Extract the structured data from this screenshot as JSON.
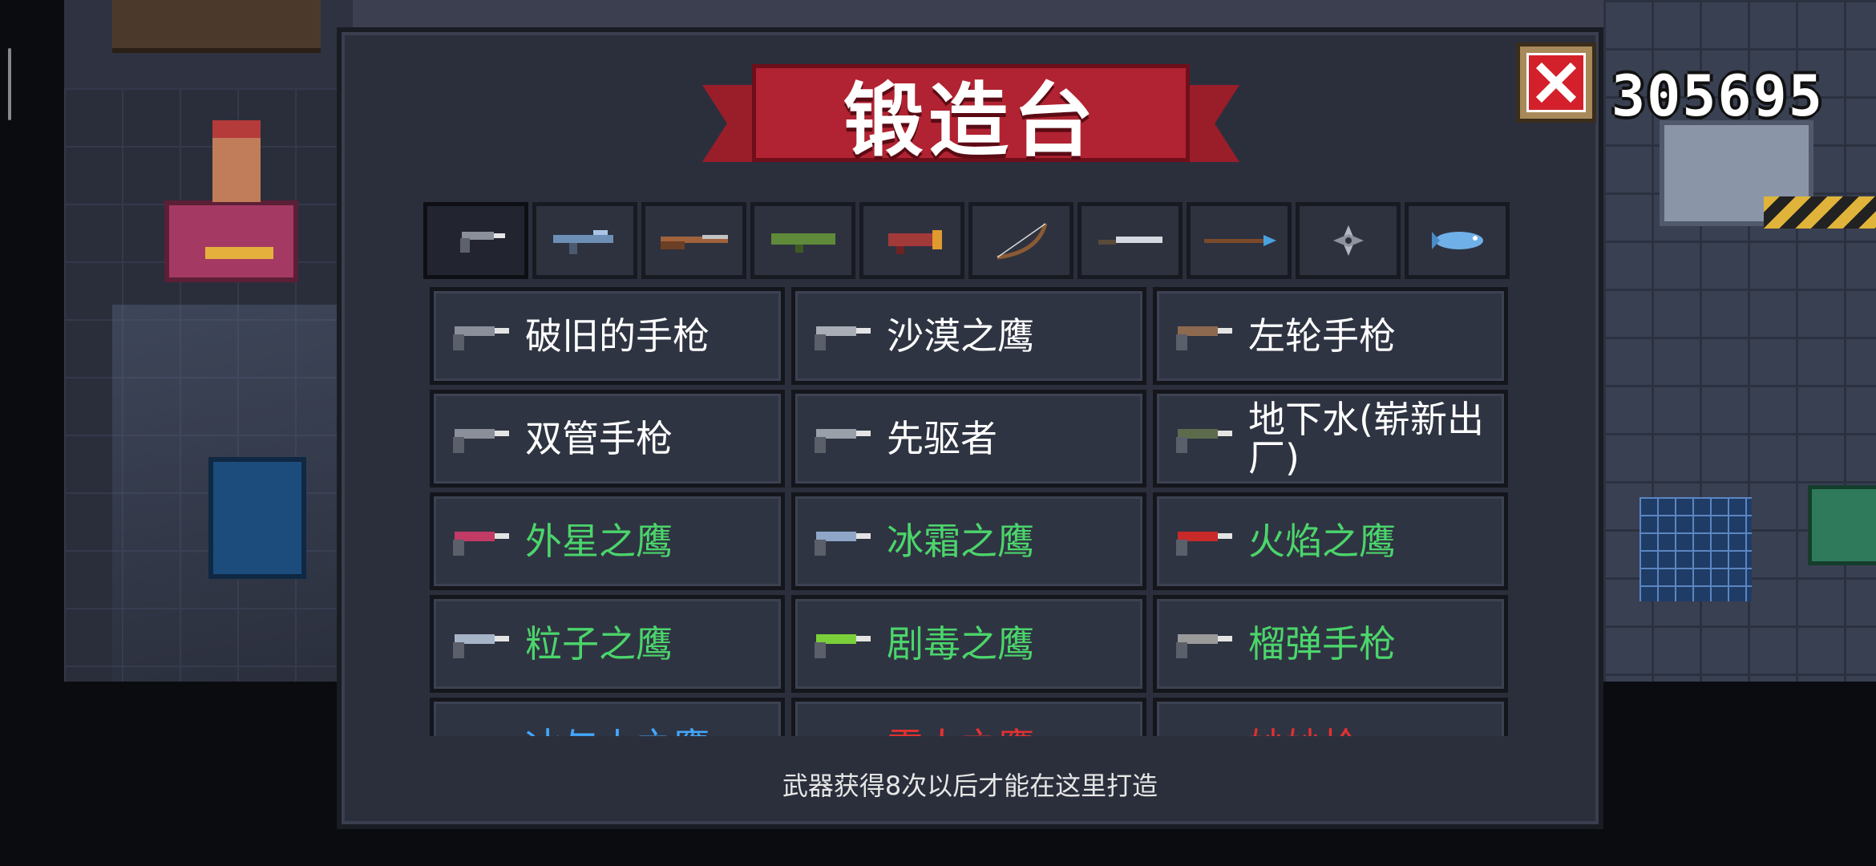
{
  "title": "锻造台",
  "coins": "305695",
  "close_icon": "close-icon",
  "colors": {
    "common": "#ffffff",
    "rare": "#4bd56b",
    "epic": "#43a8ff",
    "legendary": "#e53030",
    "ribbon": "#b12332"
  },
  "tabs": [
    {
      "name": "pistol",
      "icon": "pistol-icon",
      "active": true
    },
    {
      "name": "rifle",
      "icon": "rifle-icon"
    },
    {
      "name": "shotgun",
      "icon": "shotgun-icon"
    },
    {
      "name": "launcher",
      "icon": "launcher-icon"
    },
    {
      "name": "laser",
      "icon": "laser-icon"
    },
    {
      "name": "bow",
      "icon": "bow-icon"
    },
    {
      "name": "melee",
      "icon": "sword-icon"
    },
    {
      "name": "spear",
      "icon": "spear-icon"
    },
    {
      "name": "throwing",
      "icon": "shuriken-icon"
    },
    {
      "name": "other",
      "icon": "fish-icon"
    }
  ],
  "weapons": [
    {
      "label": "破旧的手枪",
      "rarity": "common"
    },
    {
      "label": "沙漠之鹰",
      "rarity": "common"
    },
    {
      "label": "左轮手枪",
      "rarity": "common"
    },
    {
      "label": "双管手枪",
      "rarity": "common"
    },
    {
      "label": "先驱者",
      "rarity": "common"
    },
    {
      "label": "地下水(崭新出厂)",
      "rarity": "common"
    },
    {
      "label": "外星之鹰",
      "rarity": "rare"
    },
    {
      "label": "冰霜之鹰",
      "rarity": "rare"
    },
    {
      "label": "火焰之鹰",
      "rarity": "rare"
    },
    {
      "label": "粒子之鹰",
      "rarity": "rare"
    },
    {
      "label": "剧毒之鹰",
      "rarity": "rare"
    },
    {
      "label": "榴弹手枪",
      "rarity": "rare"
    },
    {
      "label": "冰与火之鹰",
      "rarity": "epic"
    },
    {
      "label": "雷人之鹰",
      "rarity": "legendary"
    },
    {
      "label": "妙妙枪",
      "rarity": "legendary"
    }
  ],
  "hint": "武器获得8次以后才能在这里打造"
}
